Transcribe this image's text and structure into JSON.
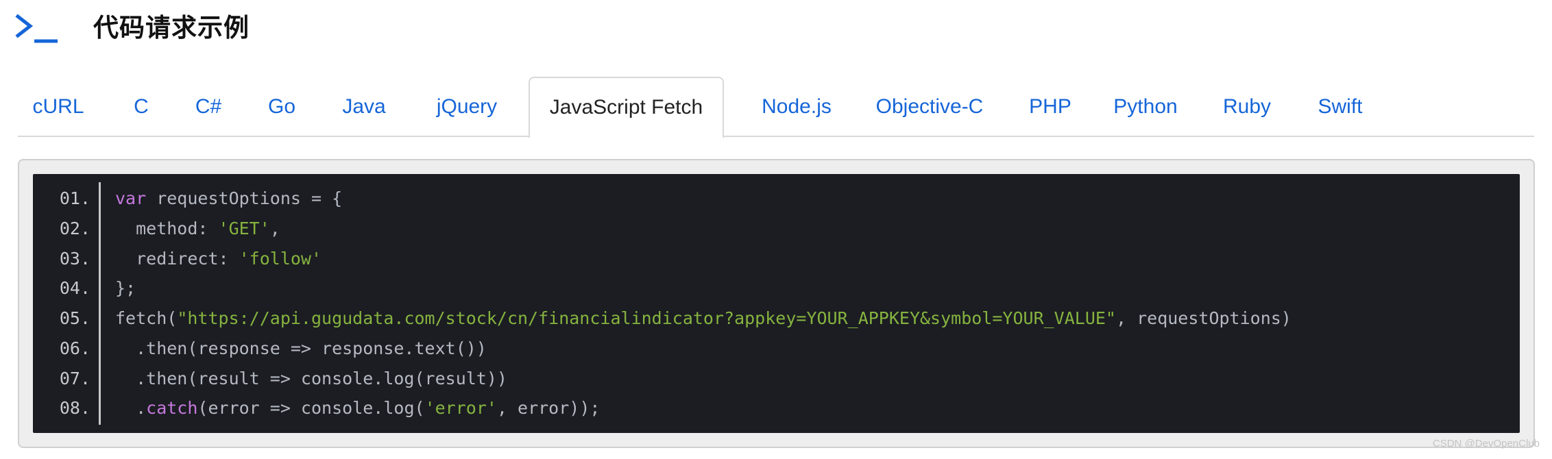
{
  "header": {
    "icon": "terminal-prompt-icon",
    "title": "代码请求示例",
    "accent_color": "#1565d8"
  },
  "tabs": [
    {
      "label": "cURL"
    },
    {
      "label": "C"
    },
    {
      "label": "C#"
    },
    {
      "label": "Go"
    },
    {
      "label": "Java"
    },
    {
      "label": "jQuery"
    },
    {
      "label": "JavaScript Fetch",
      "active": true
    },
    {
      "label": "Node.js"
    },
    {
      "label": "Objective-C"
    },
    {
      "label": "PHP"
    },
    {
      "label": "Python"
    },
    {
      "label": "Ruby"
    },
    {
      "label": "Swift"
    }
  ],
  "code": {
    "lines": [
      {
        "num": "01.",
        "tokens": [
          {
            "t": "kw",
            "v": "var"
          },
          {
            "t": "pl",
            "v": " requestOptions = {"
          }
        ]
      },
      {
        "num": "02.",
        "tokens": [
          {
            "t": "pl",
            "v": "  method: "
          },
          {
            "t": "str",
            "v": "'GET'"
          },
          {
            "t": "pl",
            "v": ","
          }
        ]
      },
      {
        "num": "03.",
        "tokens": [
          {
            "t": "pl",
            "v": "  redirect: "
          },
          {
            "t": "str",
            "v": "'follow'"
          }
        ]
      },
      {
        "num": "04.",
        "tokens": [
          {
            "t": "pl",
            "v": "};"
          }
        ]
      },
      {
        "num": "05.",
        "tokens": [
          {
            "t": "pl",
            "v": "fetch("
          },
          {
            "t": "str",
            "v": "\"https://api.gugudata.com/stock/cn/financialindicator?appkey=YOUR_APPKEY&symbol=YOUR_VALUE\""
          },
          {
            "t": "pl",
            "v": ", requestOptions)"
          }
        ]
      },
      {
        "num": "06.",
        "tokens": [
          {
            "t": "pl",
            "v": "  .then(response => response.text())"
          }
        ]
      },
      {
        "num": "07.",
        "tokens": [
          {
            "t": "pl",
            "v": "  .then(result => console.log(result))"
          }
        ]
      },
      {
        "num": "08.",
        "tokens": [
          {
            "t": "pl",
            "v": "  ."
          },
          {
            "t": "kw",
            "v": "catch"
          },
          {
            "t": "pl",
            "v": "(error => console.log("
          },
          {
            "t": "str",
            "v": "'error'"
          },
          {
            "t": "pl",
            "v": ", error));"
          }
        ]
      }
    ]
  },
  "watermark": "CSDN @DevOpenClub"
}
